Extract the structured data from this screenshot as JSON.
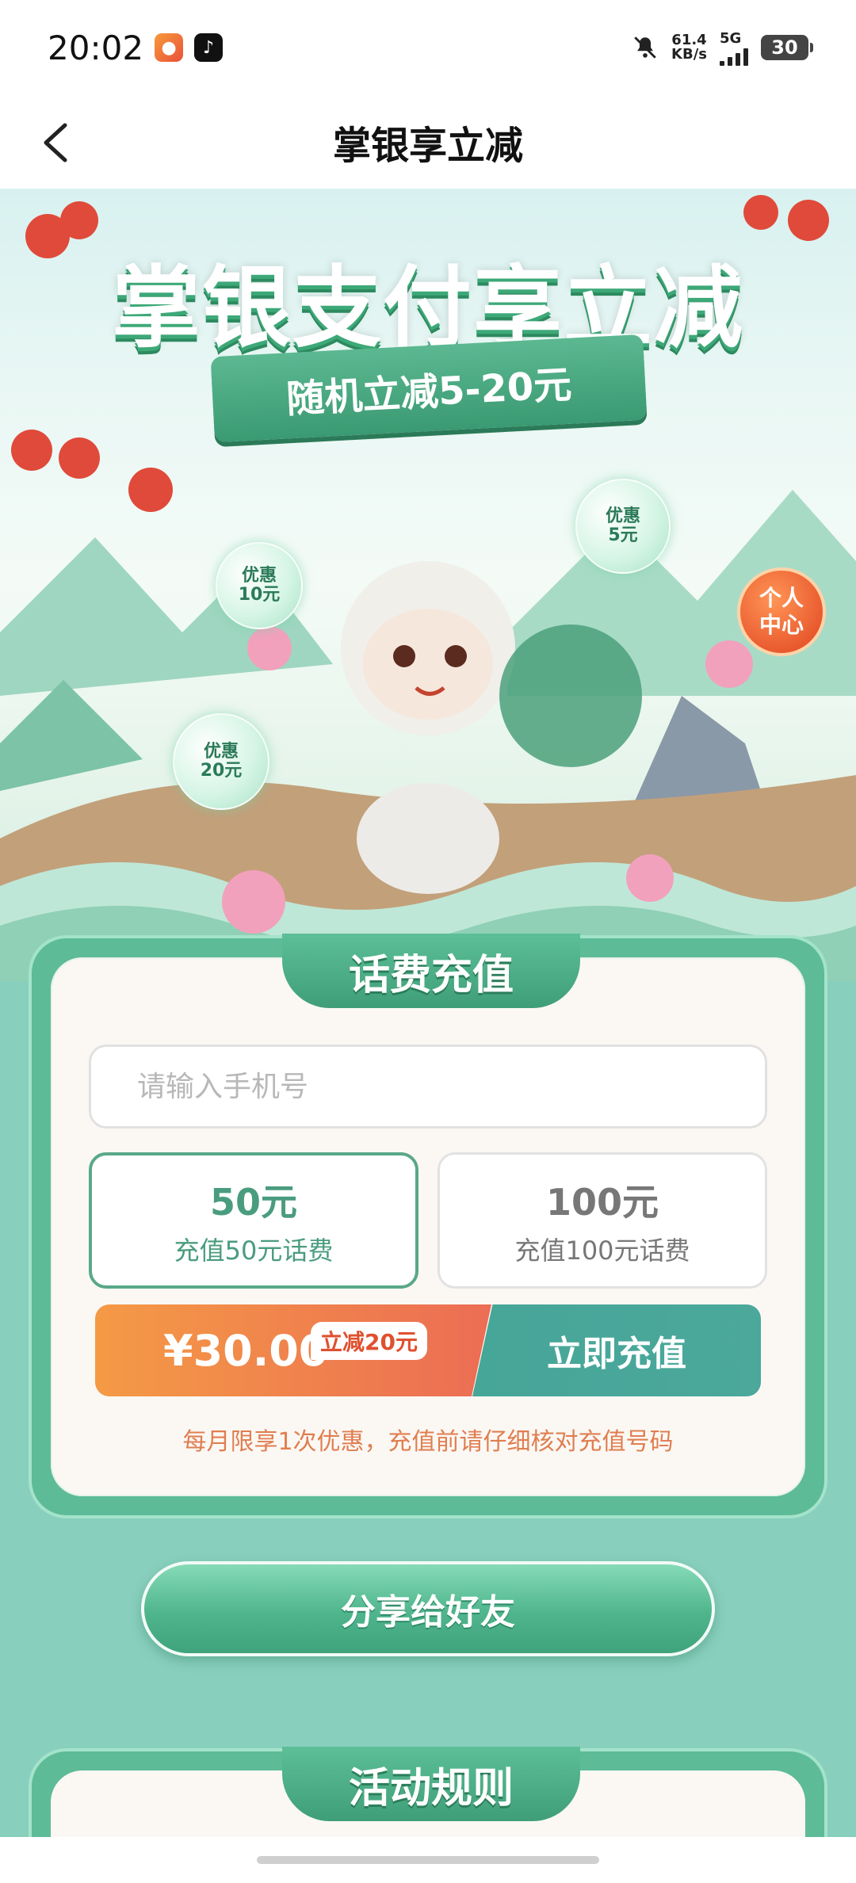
{
  "status_bar": {
    "time": "20:02",
    "net_speed_value": "61.4",
    "net_speed_unit": "KB/s",
    "network": "5G",
    "battery": "30",
    "icons": [
      "app-icon",
      "tiktok-icon",
      "mute-bell-icon",
      "signal-icon",
      "battery-icon"
    ]
  },
  "nav": {
    "title": "掌银享立减",
    "back_icon": "chevron-left-icon"
  },
  "hero": {
    "title": "掌银支付享立减",
    "ribbon": "随机立减5-20元",
    "bubbles": [
      {
        "line1": "优惠",
        "line2": "10元"
      },
      {
        "line1": "优惠",
        "line2": "5元"
      },
      {
        "line1": "优惠",
        "line2": "20元"
      }
    ],
    "personal_center": {
      "line1": "个人",
      "line2": "中心"
    }
  },
  "recharge": {
    "title": "话费充值",
    "phone_placeholder": "请输入手机号",
    "options": [
      {
        "amount": "50元",
        "desc": "充值50元话费",
        "selected": true
      },
      {
        "amount": "100元",
        "desc": "充值100元话费",
        "selected": false
      }
    ],
    "price": "¥30.00",
    "discount_badge": "立减20元",
    "submit": "立即充值",
    "note": "每月限享1次优惠，充值前请仔细核对充值号码"
  },
  "share_button": "分享给好友",
  "rules": {
    "title": "活动规则"
  },
  "colors": {
    "brand_green": "#3f9e78",
    "page_bg": "#88cfbd",
    "pay_orange": "#ec6d54",
    "pay_teal": "#46a698",
    "note_orange": "#e07e50"
  }
}
